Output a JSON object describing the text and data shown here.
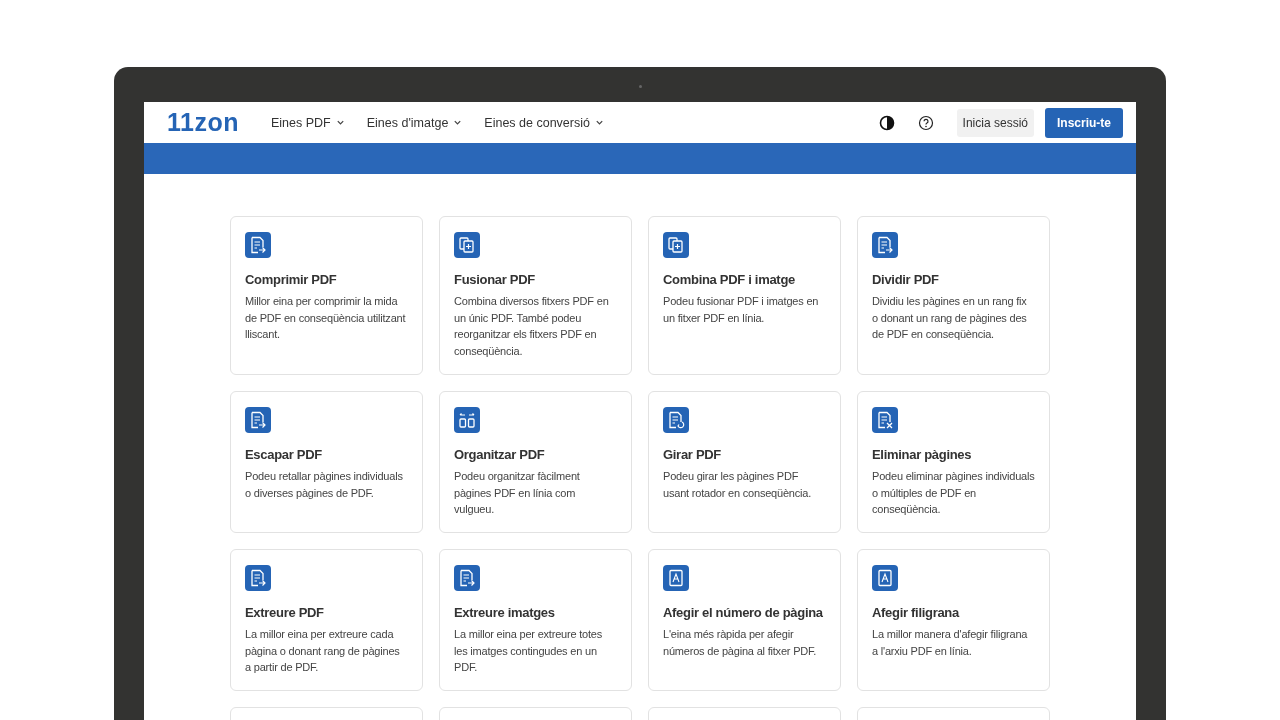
{
  "header": {
    "logo": "11zon",
    "nav": [
      {
        "label": "Eines PDF"
      },
      {
        "label": "Eines d'imatge"
      },
      {
        "label": "Eines de conversió"
      }
    ],
    "login": "Inicia sessió",
    "signup": "Inscriu-te"
  },
  "cards": [
    {
      "kind": "tool",
      "title": "Comprimir PDF",
      "text": "Millor eina per comprimir la mida de PDF en conseqüència utilitzant lliscant."
    },
    {
      "kind": "tool",
      "title": "Fusionar PDF",
      "text": "Combina diversos fitxers PDF en un únic PDF. També podeu reorganitzar els fitxers PDF en conseqüència."
    },
    {
      "kind": "tool",
      "title": "Combina PDF i imatge",
      "text": "Podeu fusionar PDF i imatges en un fitxer PDF en línia."
    },
    {
      "kind": "tool",
      "title": "Dividir PDF",
      "text": "Dividiu les pàgines en un rang fix o donant un rang de pàgines des de PDF en conseqüència."
    },
    {
      "kind": "tool",
      "title": "Escapar PDF",
      "text": "Podeu retallar pàgines individuals o diverses pàgines de PDF."
    },
    {
      "kind": "tool",
      "title": "Organitzar PDF",
      "text": "Podeu organitzar fàcilment pàgines PDF en línia com vulgueu."
    },
    {
      "kind": "tool",
      "title": "Girar PDF",
      "text": "Podeu girar les pàgines PDF usant rotador en conseqüència."
    },
    {
      "kind": "tool",
      "title": "Eliminar pàgines",
      "text": "Podeu eliminar pàgines individuals o múltiples de PDF en conseqüència."
    },
    {
      "kind": "tool",
      "title": "Extreure PDF",
      "text": "La millor eina per extreure cada pàgina o donant rang de pàgines a partir de PDF."
    },
    {
      "kind": "tool",
      "title": "Extreure imatges",
      "text": "La millor eina per extreure totes les imatges contingudes en un PDF."
    },
    {
      "kind": "tool",
      "title": "Afegir el número de pàgina",
      "text": "L'eina més ràpida per afegir números de pàgina al fitxer PDF."
    },
    {
      "kind": "tool",
      "title": "Afegir filigrana",
      "text": "La millor manera d'afegir filigrana a l'arxiu PDF en línia."
    },
    {
      "kind": "blank"
    },
    {
      "kind": "blank"
    },
    {
      "kind": "blank"
    },
    {
      "kind": "blank"
    }
  ]
}
